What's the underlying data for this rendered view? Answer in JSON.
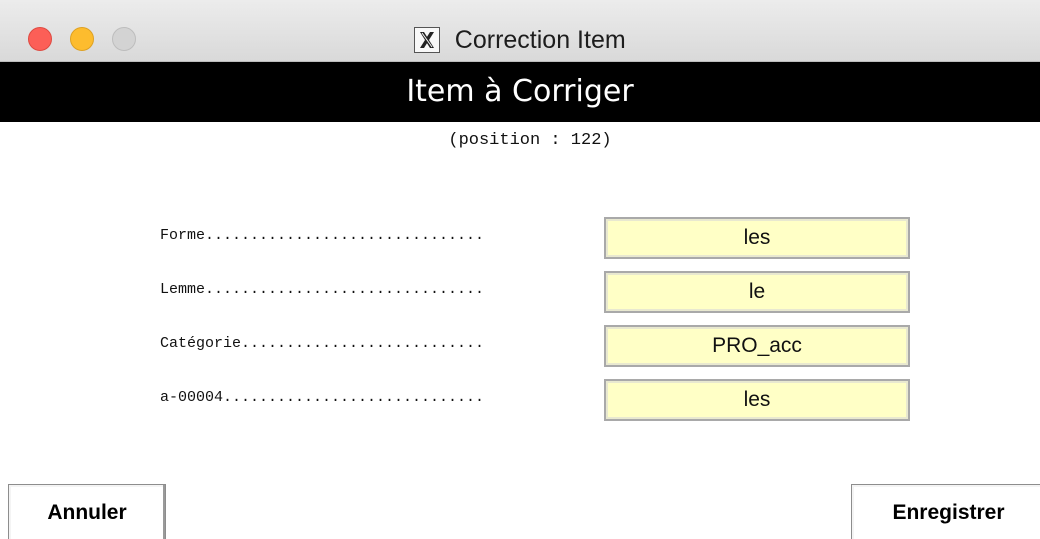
{
  "window": {
    "title": "Correction Item",
    "app_icon": "x11-icon"
  },
  "header": {
    "title": "Item à Corriger",
    "subtitle": "(position : 122)"
  },
  "form": {
    "rows": [
      {
        "label": "Forme...............................",
        "value": "les"
      },
      {
        "label": "Lemme...............................",
        "value": "le"
      },
      {
        "label": "Catégorie...........................",
        "value": "PRO_acc"
      },
      {
        "label": "a-00004.............................",
        "value": "les"
      }
    ]
  },
  "buttons": {
    "cancel_label": "Annuler",
    "save_label": "Enregistrer"
  },
  "colors": {
    "field_background": "#ffffc6",
    "header_background": "#000000",
    "close_dot": "#fc5f57",
    "minimize_dot": "#fdbc2e",
    "zoom_dot": "#d3d3d3"
  }
}
